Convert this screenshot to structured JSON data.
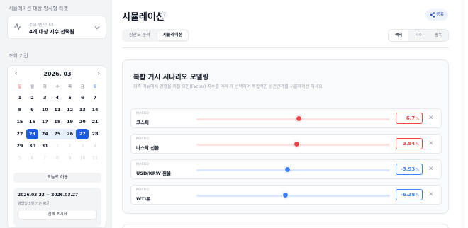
{
  "sidebar": {
    "target_label": "시뮬레이션 대상 방사형 타겟",
    "benchmark": {
      "sub_label": "주요 벤치마크",
      "value": "4개 대상 지수 선택됨",
      "icon": "activity-icon"
    },
    "period_label": "조회 기간",
    "calendar": {
      "month": "2026. 03",
      "weekdays": [
        "일",
        "월",
        "화",
        "수",
        "목",
        "금",
        "토"
      ],
      "weeks": [
        [
          "1",
          "2",
          "3",
          "4",
          "5",
          "6",
          "7"
        ],
        [
          "8",
          "9",
          "10",
          "11",
          "12",
          "13",
          "14"
        ],
        [
          "15",
          "16",
          "17",
          "18",
          "19",
          "20",
          "21"
        ],
        [
          "22",
          "23",
          "24",
          "25",
          "26",
          "27",
          "28"
        ],
        [
          "29",
          "30",
          "31",
          "1",
          "2",
          "3",
          "4"
        ],
        [
          "5",
          "6",
          "7",
          "8",
          "9",
          "10",
          "11"
        ]
      ],
      "range_start": "23",
      "range_end": "27",
      "today_button": "오늘로 이동"
    },
    "range": {
      "text": "2026.03.23 ~ 2026.03.27",
      "sub": "영업일 5일 기간 평균",
      "reset_button": "선택 초기화"
    }
  },
  "header": {
    "title": "시뮬레이션",
    "help": "?",
    "share_label": "공유"
  },
  "tabs": [
    {
      "label": "상관도 분석",
      "active": false
    },
    {
      "label": "시뮬레이션",
      "active": true
    }
  ],
  "segment": [
    {
      "label": "섹터",
      "active": true
    },
    {
      "label": "지수",
      "active": false
    },
    {
      "label": "종목",
      "active": false
    }
  ],
  "card": {
    "title": "복합 거시 시나리오 모델링",
    "desc": "좌측 메뉴에서 영향을 끼칠 요인(Factor) 지수를 여러 개 선택하여 복합적인 상관관계를 시뮬레이션 하세요.",
    "factors": [
      {
        "tag": "MACRO",
        "name": "코스피",
        "value": "6.7",
        "unit": "%",
        "level": 0.53,
        "direction": "up"
      },
      {
        "tag": "MACRO",
        "name": "나스닥 선물",
        "value": "3.84",
        "unit": "%",
        "level": 0.52,
        "direction": "up"
      },
      {
        "tag": "MACRO",
        "name": "USD/KRW 환율",
        "value": "-3.93",
        "unit": "%",
        "level": 0.47,
        "direction": "down"
      },
      {
        "tag": "MACRO",
        "name": "WTI유",
        "value": "-6.38",
        "unit": "%",
        "level": 0.46,
        "direction": "down"
      }
    ]
  },
  "colors": {
    "up": "#ef4444",
    "up_track": "#fde2e2",
    "down": "#3b82f6",
    "down_track": "#dbe7fd",
    "accent": "#1d5be0"
  }
}
